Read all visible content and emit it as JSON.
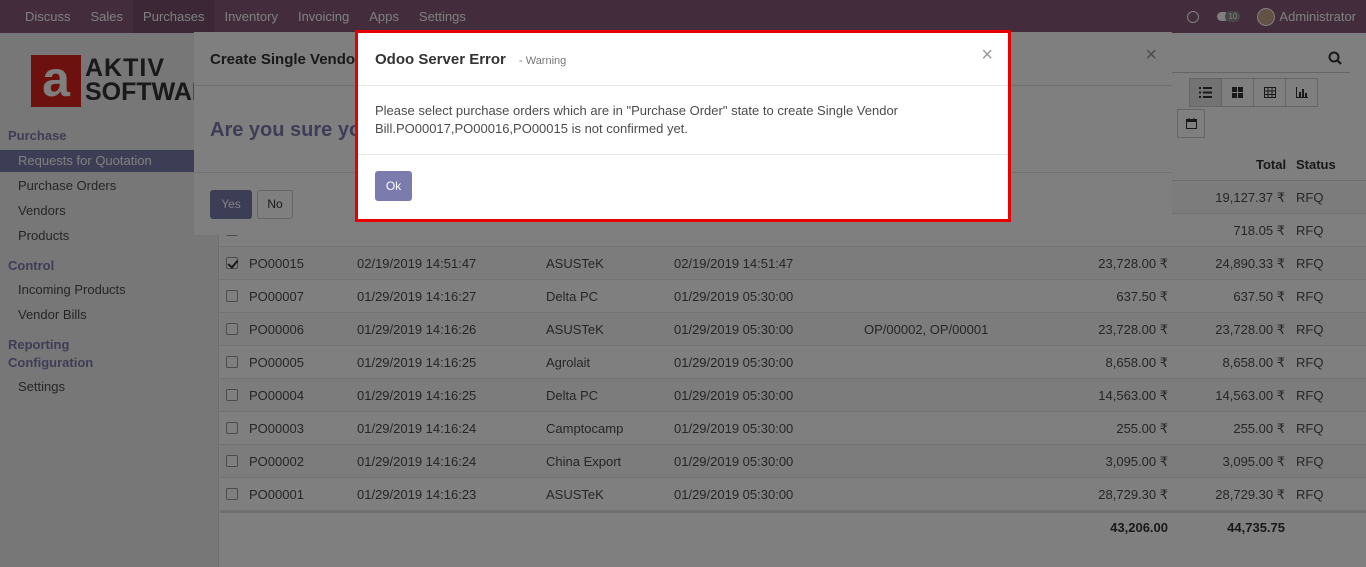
{
  "topbar": {
    "menu": [
      "Discuss",
      "Sales",
      "Purchases",
      "Inventory",
      "Invoicing",
      "Apps",
      "Settings"
    ],
    "active_menu": "Purchases",
    "chat_badge": "10",
    "user": "Administrator"
  },
  "logo": {
    "line1": "AKTIV",
    "line2": "SOFTWARE",
    "letter": "a"
  },
  "sidebar": {
    "sections": [
      {
        "title": "Purchase",
        "items": [
          "Requests for Quotation",
          "Purchase Orders",
          "Vendors",
          "Products"
        ]
      },
      {
        "title": "Control",
        "items": [
          "Incoming Products",
          "Vendor Bills"
        ]
      },
      {
        "title": "Reporting",
        "items": []
      },
      {
        "title": "Configuration",
        "items": [
          "Settings"
        ]
      }
    ],
    "active_item": "Requests for Quotation"
  },
  "table": {
    "headers": {
      "total": "Total",
      "status": "Status"
    },
    "rows": [
      {
        "ref": "",
        "date": "",
        "vendor": "",
        "sched": "",
        "source": "",
        "untaxed": "",
        "total": "19,127.37 ₹",
        "status": "RFQ",
        "checked": false
      },
      {
        "ref": "",
        "date": "",
        "vendor": "",
        "sched": "",
        "source": "",
        "untaxed": "",
        "total": "718.05 ₹",
        "status": "RFQ",
        "checked": false
      },
      {
        "ref": "PO00015",
        "date": "02/19/2019 14:51:47",
        "vendor": "ASUSTeK",
        "sched": "02/19/2019 14:51:47",
        "source": "",
        "untaxed": "23,728.00 ₹",
        "total": "24,890.33 ₹",
        "status": "RFQ",
        "checked": true
      },
      {
        "ref": "PO00007",
        "date": "01/29/2019 14:16:27",
        "vendor": "Delta PC",
        "sched": "01/29/2019 05:30:00",
        "source": "",
        "untaxed": "637.50 ₹",
        "total": "637.50 ₹",
        "status": "RFQ",
        "checked": false
      },
      {
        "ref": "PO00006",
        "date": "01/29/2019 14:16:26",
        "vendor": "ASUSTeK",
        "sched": "01/29/2019 05:30:00",
        "source": "OP/00002, OP/00001",
        "untaxed": "23,728.00 ₹",
        "total": "23,728.00 ₹",
        "status": "RFQ",
        "checked": false
      },
      {
        "ref": "PO00005",
        "date": "01/29/2019 14:16:25",
        "vendor": "Agrolait",
        "sched": "01/29/2019 05:30:00",
        "source": "",
        "untaxed": "8,658.00 ₹",
        "total": "8,658.00 ₹",
        "status": "RFQ",
        "checked": false
      },
      {
        "ref": "PO00004",
        "date": "01/29/2019 14:16:25",
        "vendor": "Delta PC",
        "sched": "01/29/2019 05:30:00",
        "source": "",
        "untaxed": "14,563.00 ₹",
        "total": "14,563.00 ₹",
        "status": "RFQ",
        "checked": false
      },
      {
        "ref": "PO00003",
        "date": "01/29/2019 14:16:24",
        "vendor": "Camptocamp",
        "sched": "01/29/2019 05:30:00",
        "source": "",
        "untaxed": "255.00 ₹",
        "total": "255.00 ₹",
        "status": "RFQ",
        "checked": false
      },
      {
        "ref": "PO00002",
        "date": "01/29/2019 14:16:24",
        "vendor": "China Export",
        "sched": "01/29/2019 05:30:00",
        "source": "",
        "untaxed": "3,095.00 ₹",
        "total": "3,095.00 ₹",
        "status": "RFQ",
        "checked": false
      },
      {
        "ref": "PO00001",
        "date": "01/29/2019 14:16:23",
        "vendor": "ASUSTeK",
        "sched": "01/29/2019 05:30:00",
        "source": "",
        "untaxed": "28,729.30 ₹",
        "total": "28,729.30 ₹",
        "status": "RFQ",
        "checked": false
      }
    ],
    "footer": {
      "untaxed": "43,206.00",
      "total": "44,735.75"
    }
  },
  "confirm_dialog": {
    "title": "Create Single Vendo",
    "question": "Are you sure yo",
    "yes": "Yes",
    "no": "No",
    "close": "×"
  },
  "error_dialog": {
    "title": "Odoo Server Error",
    "subtitle": "- Warning",
    "message_line1": "Please select purchase orders which are in \"Purchase Order\" state to create Single Vendor",
    "message_line2": "Bill.PO00017,PO00016,PO00015 is not confirmed yet.",
    "ok": "Ok",
    "close": "×"
  },
  "colors": {
    "brand": "#875a7b",
    "accent": "#7c7bad",
    "error_outline": "#e60000"
  }
}
